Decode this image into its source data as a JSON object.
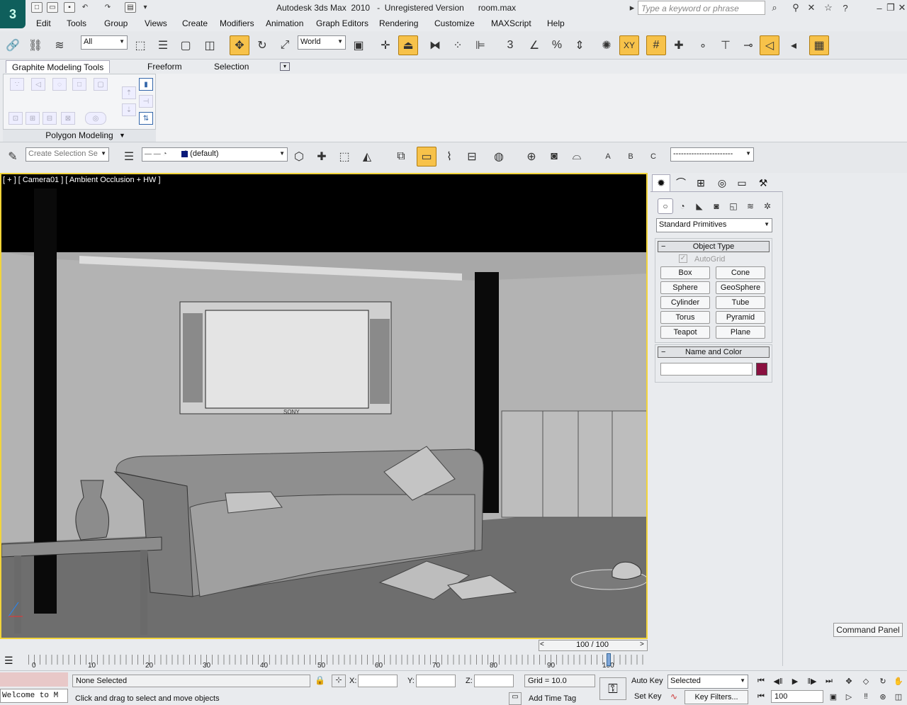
{
  "app": {
    "title": "Autodesk 3ds Max  2010   -  Unregistered Version      room.max",
    "search_placeholder": "Type a keyword or phrase"
  },
  "menus": [
    "Edit",
    "Tools",
    "Group",
    "Views",
    "Create",
    "Modifiers",
    "Animation",
    "Graph Editors",
    "Rendering",
    "Customize",
    "MAXScript",
    "Help"
  ],
  "toolbar": {
    "selection_filter": "All",
    "ref_coord": "World",
    "accent_color": "#f7c24a"
  },
  "ribbon": {
    "tabs": [
      "Graphite Modeling Tools",
      "Freeform",
      "Selection"
    ],
    "active_tab": "Graphite Modeling Tools",
    "panel_label": "Polygon Modeling"
  },
  "layerbar": {
    "named_selection_placeholder": "Create Selection Se",
    "layer_value": "0 (default)",
    "abc_labels": [
      "A",
      "B",
      "C"
    ],
    "line_combo": "-----------------------"
  },
  "viewport": {
    "label": "[ + ] [ Camera01 ] [ Ambient Occlusion + HW ]",
    "tv_label": "SONY",
    "border_color": "#f2d43a"
  },
  "command_panel": {
    "category": "Standard Primitives",
    "object_type_title": "Object Type",
    "autogrid_label": "AutoGrid",
    "buttons": [
      "Box",
      "Cone",
      "Sphere",
      "GeoSphere",
      "Cylinder",
      "Tube",
      "Torus",
      "Pyramid",
      "Teapot",
      "Plane"
    ],
    "name_color_title": "Name and Color",
    "name_value": "",
    "object_color": "#8a1040",
    "floating_button": "Command Panel"
  },
  "timeline": {
    "slider_text": "100 / 100",
    "ticks": [
      "0",
      "10",
      "20",
      "30",
      "40",
      "50",
      "60",
      "70",
      "80",
      "90",
      "100"
    ]
  },
  "status": {
    "maxscript": "Welcome to M",
    "selection": "None Selected",
    "prompt": "Click and drag to select and move objects",
    "x_label": "X:",
    "y_label": "Y:",
    "z_label": "Z:",
    "grid": "Grid = 10.0",
    "add_time_tag": "Add Time Tag",
    "auto_key": "Auto Key",
    "set_key": "Set Key",
    "key_mode": "Selected",
    "key_filters": "Key Filters...",
    "frame": "100"
  }
}
